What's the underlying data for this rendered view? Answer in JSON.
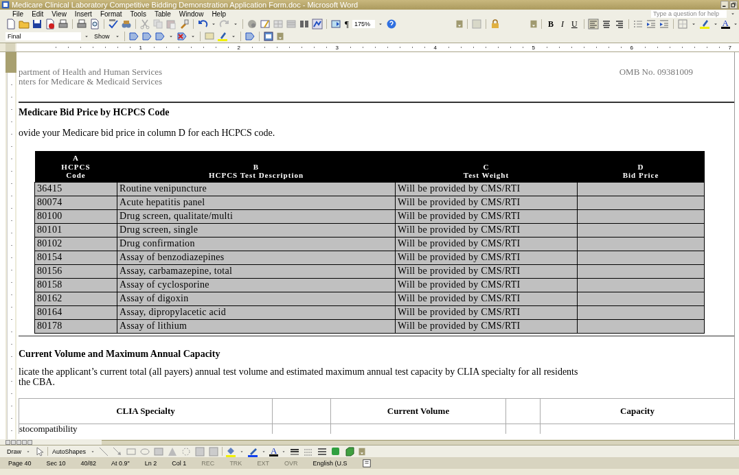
{
  "window": {
    "title": "Medicare Clinical Laboratory Competitive Bidding Demonstration Application Form.doc - Microsoft Word"
  },
  "menu": [
    "File",
    "Edit",
    "View",
    "Insert",
    "Format",
    "Tools",
    "Table",
    "Window",
    "Help"
  ],
  "help_box": {
    "placeholder": "Type a question for help"
  },
  "standard_toolbar": {
    "pilcrow": "¶",
    "zoom": "175%"
  },
  "formatting_toolbar": {
    "bold": "B",
    "italic": "I",
    "underline": "U",
    "font_color": "A"
  },
  "reviewing_toolbar": {
    "display": "Final",
    "show": "Show"
  },
  "ruler": [
    "1",
    "2",
    "3",
    "4",
    "5",
    "6",
    "7"
  ],
  "document": {
    "header_lines": [
      "partment of Health and Human Services",
      "nters for Medicare & Medicaid Services"
    ],
    "omb": "OMB No. 09381009",
    "heading_1": "Medicare Bid Price by HCPCS Code",
    "para_1": "ovide your Medicare bid price in column D for each HCPCS code.",
    "table_1": {
      "header_rows": [
        [
          "A"
        ],
        [
          "HCPCS",
          "B",
          "C",
          "D"
        ],
        [
          "Code",
          "HCPCS Test Description",
          "Test Weight",
          "Bid Price"
        ]
      ],
      "rows": [
        [
          "36415",
          "Routine venipuncture",
          "Will be provided by CMS/RTI"
        ],
        [
          "80074",
          "Acute hepatitis panel",
          "Will be provided by CMS/RTI"
        ],
        [
          "80100",
          "Drug screen, qualitate/multi",
          "Will be provided by CMS/RTI"
        ],
        [
          "80101",
          "Drug screen, single",
          "Will be provided by CMS/RTI"
        ],
        [
          "80102",
          "Drug confirmation",
          "Will be provided by CMS/RTI"
        ],
        [
          "80154",
          "Assay of benzodiazepines",
          "Will be provided by CMS/RTI"
        ],
        [
          "80156",
          "Assay, carbamazepine, total",
          "Will be provided by CMS/RTI"
        ],
        [
          "80158",
          "Assay of cyclosporine",
          "Will be provided by CMS/RTI"
        ],
        [
          "80162",
          "Assay of digoxin",
          "Will be provided by CMS/RTI"
        ],
        [
          "80164",
          "Assay, dipropylacetic acid",
          "Will be provided by CMS/RTI"
        ],
        [
          "80178",
          "Assay of lithium",
          "Will be provided by CMS/RTI"
        ]
      ]
    },
    "heading_2": "Current Volume and Maximum Annual Capacity",
    "para_2": [
      "licate the applicant’s current total (all payers) annual test volume and estimated maximum annual test capacity by CLIA specialty for all residents",
      "the CBA."
    ],
    "table_2": {
      "columns": [
        "CLIA Specialty",
        "Current Volume",
        "Capacity"
      ],
      "rows": [
        [
          "stocompatibility"
        ]
      ]
    }
  },
  "drawing_toolbar": {
    "draw": "Draw",
    "autoshapes": "AutoShapes",
    "font_color": "A"
  },
  "status_bar": [
    {
      "text": "Page 40",
      "disabled": false
    },
    {
      "text": "Sec 10",
      "disabled": false
    },
    {
      "text": "40/82",
      "disabled": false
    },
    {
      "text": "At 0.9\"",
      "disabled": false
    },
    {
      "text": "Ln 2",
      "disabled": false
    },
    {
      "text": "Col 1",
      "disabled": false
    },
    {
      "text": "REC",
      "disabled": true
    },
    {
      "text": "TRK",
      "disabled": true
    },
    {
      "text": "EXT",
      "disabled": true
    },
    {
      "text": "OVR",
      "disabled": true
    },
    {
      "text": "English (U.S",
      "disabled": false
    }
  ]
}
